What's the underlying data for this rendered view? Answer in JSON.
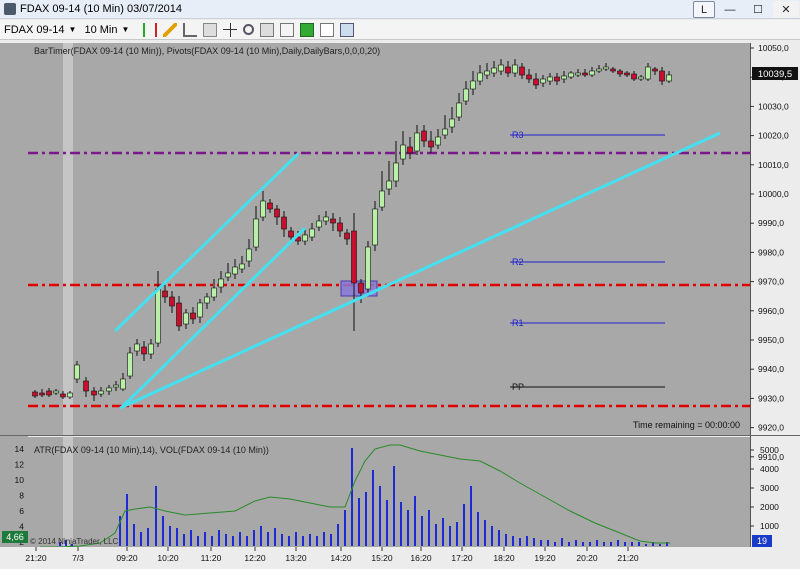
{
  "window": {
    "title": "FDAX 09-14 (10 Min)  03/07/2014",
    "l_button": "L"
  },
  "toolbar": {
    "instrument": "FDAX 09-14",
    "interval": "10 Min"
  },
  "price_panel": {
    "indicator_label": "BarTimer(FDAX 09-14 (10 Min)), Pivots(FDAX 09-14 (10 Min),Daily,DailyBars,0,0,0,20)",
    "current_price": "10039,5",
    "time_remaining": "Time remaining = 00:00:00",
    "y_ticks": [
      "10050,0",
      "10040,0",
      "10030,0",
      "10020,0",
      "10010,0",
      "10000,0",
      "9990,0",
      "9980,0",
      "9970,0",
      "9960,0",
      "9950,0",
      "9940,0",
      "9930,0",
      "9920,0",
      "9910,0"
    ],
    "pivot_labels": {
      "r3": "R3",
      "r2": "R2",
      "r1": "R1",
      "pp": "PP"
    },
    "colors": {
      "background": "#a8a8a8",
      "up_candle": "#b8f0a8",
      "down_candle": "#c8102e",
      "trendline": "#44e0f0",
      "red_level": "#e00000",
      "purple_level": "#7a1a8a",
      "pivot_line": "#2020d0"
    }
  },
  "lower_panel": {
    "indicator_label": "ATR(FDAX 09-14 (10 Min),14), VOL(FDAX 09-14 (10 Min))",
    "left_ticks": [
      "14",
      "12",
      "10",
      "8",
      "6",
      "4",
      "2"
    ],
    "right_ticks": [
      "5000",
      "4000",
      "3000",
      "2000",
      "1000"
    ],
    "atr_badge": "4,66",
    "vol_badge": "19",
    "copyright": "© 2014 NinjaTrader, LLC"
  },
  "x_axis": {
    "labels": [
      "21:20",
      "7/3",
      "09:20",
      "10:20",
      "11:20",
      "12:20",
      "13:20",
      "14:20",
      "15:20",
      "16:20",
      "17:20",
      "18:20",
      "19:20",
      "20:20",
      "21:20"
    ]
  }
}
